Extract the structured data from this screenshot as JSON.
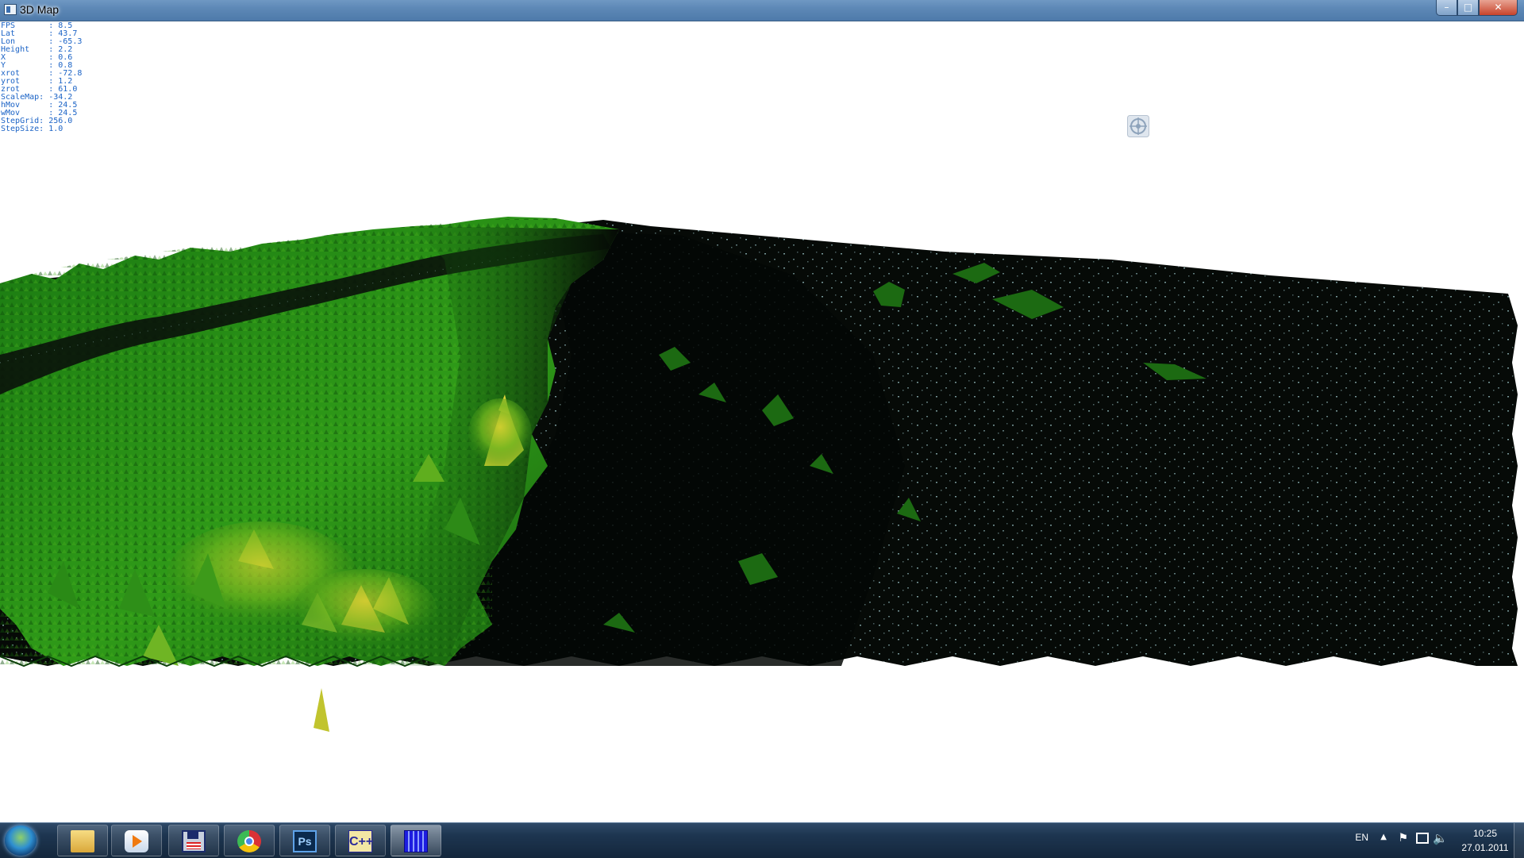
{
  "window": {
    "title": "3D Map",
    "minimize_label": "–",
    "maximize_label": "□",
    "close_label": "✕"
  },
  "hud": [
    {
      "label": "FPS       ",
      "value": ": 8.5"
    },
    {
      "label": "Lat       ",
      "value": ": 43.7"
    },
    {
      "label": "Lon       ",
      "value": ": -65.3"
    },
    {
      "label": "Height    ",
      "value": ": 2.2"
    },
    {
      "label": "X         ",
      "value": ": 0.6"
    },
    {
      "label": "Y         ",
      "value": ": 0.8"
    },
    {
      "label": "xrot      ",
      "value": ": -72.8"
    },
    {
      "label": "yrot      ",
      "value": ": 1.2"
    },
    {
      "label": "zrot      ",
      "value": ": 61.0"
    },
    {
      "label": "ScaleMap",
      "value": ": -34.2"
    },
    {
      "label": "hMov      ",
      "value": ": 24.5"
    },
    {
      "label": "wMov      ",
      "value": ": 24.5"
    },
    {
      "label": "StepGrid",
      "value": ": 256.0"
    },
    {
      "label": "StepSize",
      "value": ": 1.0"
    }
  ],
  "colors": {
    "terrain_dark_green": "#0b4a0b",
    "terrain_green": "#1f8a14",
    "terrain_light_green": "#4fb81d",
    "peak_yellow": "#c6c52a",
    "water_dark": "#070b08",
    "water_speckle": "#9fc8cc",
    "hud_text": "#1b63c6"
  },
  "taskbar": {
    "apps": [
      {
        "icon": "folder-icon",
        "active": false
      },
      {
        "icon": "media-player-icon",
        "active": false
      },
      {
        "icon": "save-disk-icon",
        "active": false
      },
      {
        "icon": "chrome-icon",
        "active": false
      },
      {
        "icon": "photoshop-icon",
        "label": "Ps",
        "active": false
      },
      {
        "icon": "cpp-builder-icon",
        "label": "C++",
        "active": false
      },
      {
        "icon": "grid-app-icon",
        "active": true
      }
    ],
    "language": "EN",
    "time": "10:25",
    "date": "27.01.2011"
  }
}
